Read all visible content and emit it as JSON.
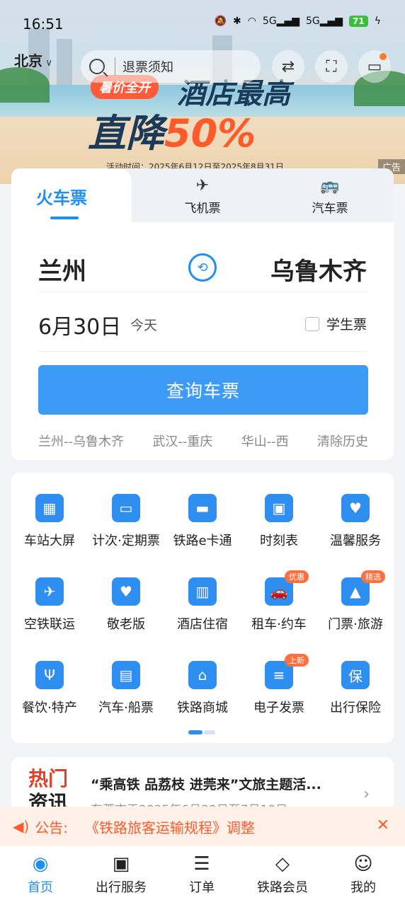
{
  "status": {
    "time": "16:51",
    "icons": [
      "mute-icon",
      "bluetooth-icon",
      "wifi-icon",
      "5g-signal-icon",
      "5g-signal-icon"
    ],
    "battery": "71"
  },
  "header": {
    "city": "北京",
    "search_placeholder": "退票须知"
  },
  "banner": {
    "tag": "暑价全开",
    "line1": "酒店最高",
    "line2_a": "直降",
    "line2_b": "50%",
    "date": "活动时间：2025年6月12日至2025年8月31日",
    "ad": "广告"
  },
  "tabs": [
    {
      "label": "火车票"
    },
    {
      "label": "飞机票"
    },
    {
      "label": "汽车票"
    }
  ],
  "ticket": {
    "from": "兰州",
    "to": "乌鲁木齐",
    "date": "6月30日",
    "today": "今天",
    "student": "学生票",
    "search_button": "查询车票"
  },
  "history": [
    "兰州--乌鲁木齐",
    "武汉--重庆",
    "华山--西",
    "清除历史"
  ],
  "services": [
    {
      "label": "车站大屏",
      "icon": "calendar-icon"
    },
    {
      "label": "计次·定期票",
      "icon": "ticket-clock-icon"
    },
    {
      "label": "铁路e卡通",
      "icon": "card-icon"
    },
    {
      "label": "时刻表",
      "icon": "train-icon"
    },
    {
      "label": "温馨服务",
      "icon": "heart-ticket-icon"
    },
    {
      "label": "空铁联运",
      "icon": "plane-train-icon"
    },
    {
      "label": "敬老版",
      "icon": "heart-icon"
    },
    {
      "label": "酒店住宿",
      "icon": "hotel-icon"
    },
    {
      "label": "租车·约车",
      "icon": "car-icon",
      "badge": "优惠"
    },
    {
      "label": "门票·旅游",
      "icon": "mountain-icon",
      "badge": "精选"
    },
    {
      "label": "餐饮·特产",
      "icon": "fork-knife-icon"
    },
    {
      "label": "汽车·船票",
      "icon": "bus-icon"
    },
    {
      "label": "铁路商城",
      "icon": "shop-icon"
    },
    {
      "label": "电子发票",
      "icon": "invoice-icon",
      "badge": "上新"
    },
    {
      "label": "出行保险",
      "icon": "shield-icon",
      "glyph": "保"
    }
  ],
  "news": {
    "label1": "热门",
    "label2": "资讯",
    "title": "“乘高铁 品荔枝 进莞来”文旅主题活...",
    "subtitle": "东莞市于2025年6月20日至7月10日"
  },
  "notice": {
    "label": "公告:",
    "text": "《铁路旅客运输规程》调整"
  },
  "bottom_nav": [
    {
      "label": "首页"
    },
    {
      "label": "出行服务"
    },
    {
      "label": "订单"
    },
    {
      "label": "铁路会员"
    },
    {
      "label": "我的"
    }
  ]
}
